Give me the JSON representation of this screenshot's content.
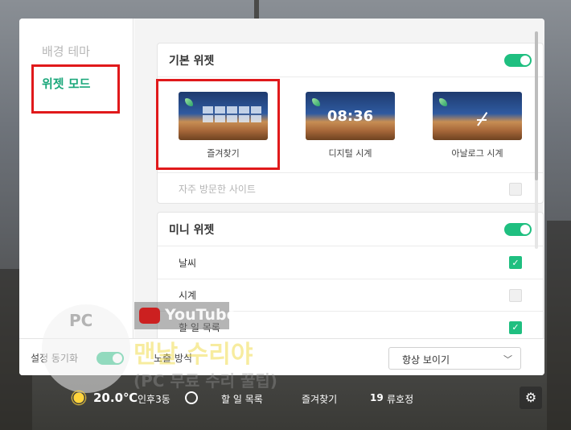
{
  "sidebar": {
    "items": [
      {
        "label": "배경 테마"
      },
      {
        "label": "위젯 모드"
      }
    ]
  },
  "basic_widget": {
    "title": "기본 위젯",
    "thumbnails": [
      {
        "label": "즐겨찾기"
      },
      {
        "label": "디지털 시계",
        "time": "08:36"
      },
      {
        "label": "아날로그 시계"
      }
    ],
    "frequent_sites_label": "자주 방문한 사이트"
  },
  "mini_widget": {
    "title": "미니 위젯",
    "items": [
      {
        "label": "날씨",
        "checked": true
      },
      {
        "label": "시계",
        "checked": false
      },
      {
        "label": "할 일 목록",
        "checked": true
      }
    ]
  },
  "footer": {
    "sync_label": "설정 동기화",
    "expose_label": "노출 방식",
    "expose_value": "항상 보이기"
  },
  "bottombar": {
    "temperature": "20.0℃",
    "location": "인후3동",
    "todo": "할 일 목록",
    "favorites": "즐겨찾기",
    "date": "19",
    "holiday": "류호정"
  },
  "watermark": {
    "pc": "PC",
    "youtube": "YouTube",
    "big": "맨날 수리야",
    "small": "(PC 무료 수리 꿀팁)"
  },
  "colors": {
    "accent": "#1aa77a",
    "toggle": "#1fbf80",
    "highlight": "#e0191b"
  }
}
